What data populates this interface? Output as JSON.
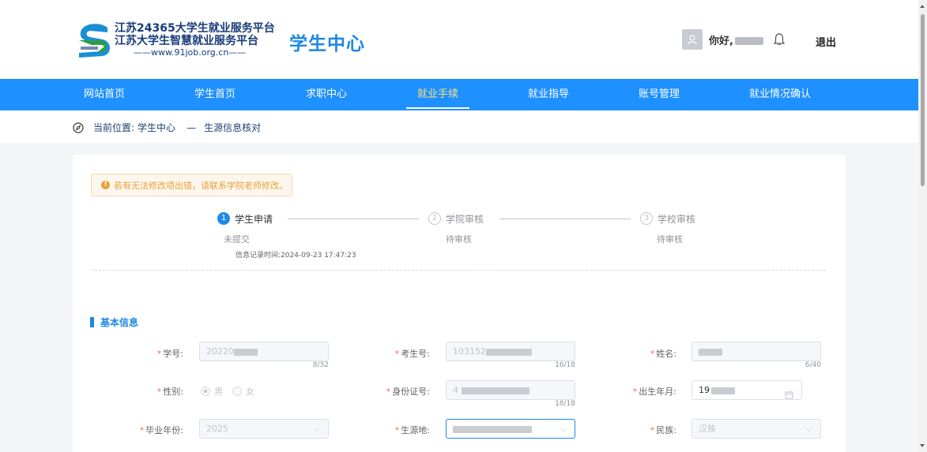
{
  "header": {
    "logo_line1": "江苏24365大学生就业服务平台",
    "logo_line2": "江苏大学生智慧就业服务平台",
    "logo_url": "——www.91job.org.cn——",
    "site_name": "学生中心",
    "greeting": "你好,",
    "logout": "退出"
  },
  "nav": {
    "items": [
      {
        "label": "网站首页"
      },
      {
        "label": "学生首页"
      },
      {
        "label": "求职中心"
      },
      {
        "label": "就业手续"
      },
      {
        "label": "就业指导"
      },
      {
        "label": "账号管理"
      },
      {
        "label": "就业情况确认"
      }
    ],
    "active": "就业手续"
  },
  "breadcrumb": {
    "prefix": "当前位置:",
    "level1": "学生中心",
    "separator": "—",
    "level2": "生源信息核对"
  },
  "notice": {
    "text": "若有无法修改项出错，请联系学院老师修改。"
  },
  "steps": [
    {
      "num": "1",
      "title": "学生申请",
      "status": "未提交",
      "time": "信息记录时间:2024-09-23 17:47:23"
    },
    {
      "num": "2",
      "title": "学院审核",
      "status": "待审核"
    },
    {
      "num": "3",
      "title": "学校审核",
      "status": "待审核"
    }
  ],
  "section": {
    "title": "基本信息"
  },
  "form": {
    "student_id": {
      "label": "学号:",
      "value": "20220",
      "count": "8/32"
    },
    "exam_id": {
      "label": "考生号:",
      "value": "103152",
      "count": "16/18"
    },
    "name": {
      "label": "姓名:",
      "count": "6/40"
    },
    "gender": {
      "label": "性别:",
      "options": [
        "男",
        "女"
      ],
      "selected": "男"
    },
    "id_card": {
      "label": "身份证号:",
      "value": "4",
      "count": "18/18"
    },
    "birth": {
      "label": "出生年月:",
      "value": "19"
    },
    "grad_year": {
      "label": "毕业年份:",
      "value": "2025"
    },
    "origin": {
      "label": "生源地:"
    },
    "ethnicity": {
      "label": "民族:",
      "value": "汉族"
    }
  },
  "colors": {
    "primary": "#1e90ff",
    "nav_active": "#ffe27a",
    "required": "#f56c6c",
    "notice": "#e6a23c"
  }
}
